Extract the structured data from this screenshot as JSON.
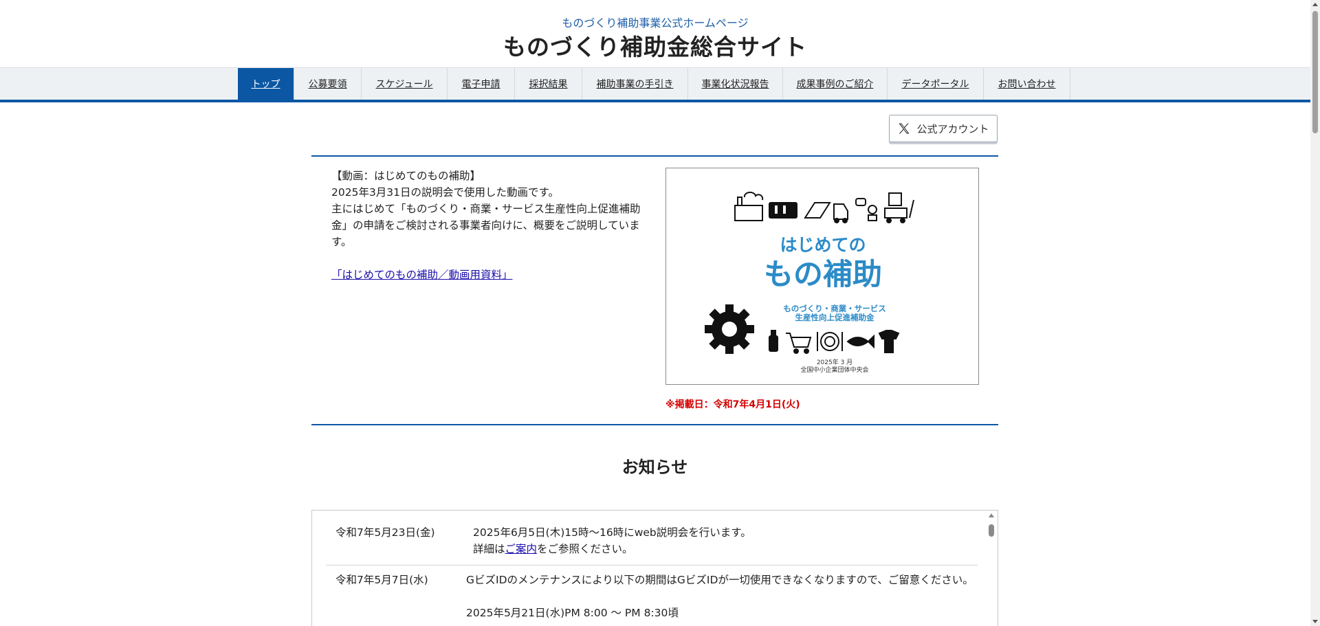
{
  "header": {
    "subtitle": "ものづくり補助事業公式ホームページ",
    "title": "ものづくり補助金総合サイト"
  },
  "nav": {
    "items": [
      {
        "label": "トップ",
        "active": true
      },
      {
        "label": "公募要領",
        "active": false
      },
      {
        "label": "スケジュール",
        "active": false
      },
      {
        "label": "電子申請",
        "active": false
      },
      {
        "label": "採択結果",
        "active": false
      },
      {
        "label": "補助事業の手引き",
        "active": false
      },
      {
        "label": "事業化状況報告",
        "active": false
      },
      {
        "label": "成果事例のご紹介",
        "active": false
      },
      {
        "label": "データポータル",
        "active": false
      },
      {
        "label": "お問い合わせ",
        "active": false
      }
    ]
  },
  "x_account": {
    "label": "公式アカウント",
    "icon": "x-logo-icon"
  },
  "video": {
    "heading": "【動画：はじめてのもの補助】",
    "line1": "2025年3月31日の説明会で使用した動画です。",
    "line2": "主にはじめて「ものづくり・商業・サービス生産性向上促進補助金」の申請をご検討される事業者向けに、概要をご説明しています。",
    "link": "「はじめてのもの補助／動画用資料」",
    "thumbnail": {
      "title_small": "はじめての",
      "title_large": "もの補助",
      "subtitle1": "ものづくり・商業・サービス",
      "subtitle2": "生産性向上促進補助金",
      "date": "2025年 3 月",
      "org": "全国中小企業団体中央会"
    },
    "posted": "※掲載日：令和7年4月1日(火)"
  },
  "news": {
    "heading": "お知らせ",
    "items": [
      {
        "date": "令和7年5月23日(金)",
        "line1": "2025年6月5日(木)15時～16時にweb説明会を行います。",
        "line2_pre": "詳細は",
        "line2_link": "ご案内",
        "line2_post": "をご参照ください。"
      },
      {
        "date": "令和7年5月7日(水)",
        "line1": "GビズIDのメンテナンスにより以下の期間はGビズIDが一切使用できなくなりますので、ご留意ください。",
        "line2": "2025年5月21日(水)PM 8:00 ～ PM 8:30頃"
      }
    ]
  },
  "colors": {
    "brand_blue": "#0b57a4",
    "thumb_blue": "#2b8bc8",
    "alert_red": "#d40000"
  }
}
